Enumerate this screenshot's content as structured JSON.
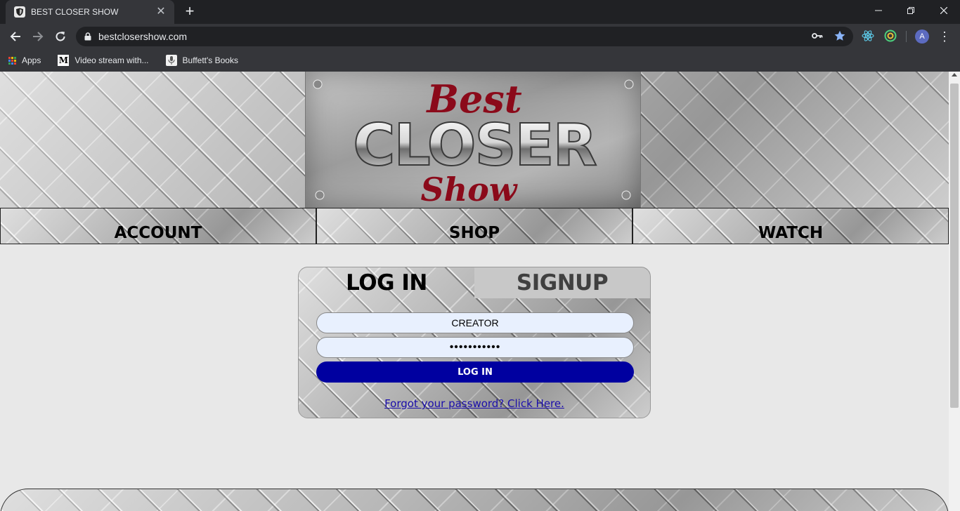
{
  "browser": {
    "tab": {
      "title": "BEST CLOSER SHOW",
      "favicon": "shield-icon"
    },
    "url": "bestclosershow.com",
    "profile_initial": "A",
    "bookmarks": [
      {
        "label": "Apps",
        "icon": "apps-grid-icon"
      },
      {
        "label": "Video stream with...",
        "icon": "medium-m-icon"
      },
      {
        "label": "Buffett's Books",
        "icon": "buffett-books-icon"
      }
    ],
    "toolbar_icons": [
      "key-icon",
      "star-icon",
      "react-devtools-icon",
      "circle-extension-icon",
      "profile-avatar",
      "kebab-menu-icon"
    ],
    "accent_star": "#8ab4f8"
  },
  "logo": {
    "line1": "Best",
    "line2": "CLOSER",
    "line3": "Show",
    "script_color": "#8b0a1a"
  },
  "nav": {
    "items": [
      "ACCOUNT",
      "SHOP",
      "WATCH"
    ]
  },
  "login": {
    "tab_login": "LOG IN",
    "tab_signup": "SIGNUP",
    "username_value": "CREATOR",
    "password_masked": "•••••••••••",
    "submit_label": "LOG IN",
    "forgot_link": "Forgot your password? Click Here.",
    "button_color": "#0000a0"
  }
}
